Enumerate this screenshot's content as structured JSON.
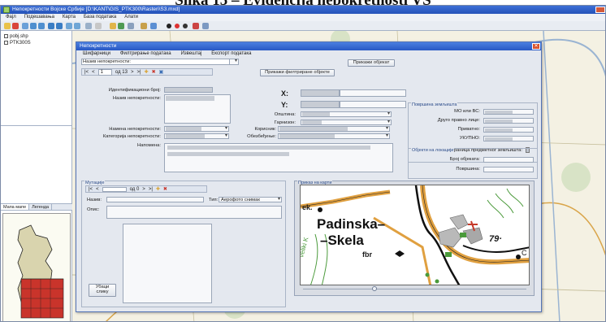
{
  "figure_heading": "Slika 15 – Evidencija nepokretnosti VS",
  "app": {
    "title": "Непокретности Војске Србије [D:\\KANT\\GIS_PTK300\\Rasteri\\S3.mxd]",
    "menu": [
      "Фајл",
      "Подешавања",
      "Карта",
      "База података",
      "Алати"
    ]
  },
  "layers": [
    "pobj.shp",
    "PTK300S"
  ],
  "left_tabs": [
    "Мапа мапе",
    "Легенда"
  ],
  "dialog": {
    "title": "Непокретности",
    "menu": [
      "Шифарници",
      "Филтрирање података",
      "Извештај",
      "Експорт података"
    ],
    "search_label": "Назив непокретности:",
    "show_object_btn": "Прикажи објекат",
    "nav_main": {
      "first": "|<",
      "prev": "<",
      "record": "1",
      "count": "од 13",
      "next": ">",
      "last": ">|",
      "add": "✚",
      "delete": "✖",
      "save": "▣"
    },
    "show_filtered_btn": "Прикажи филтриране објекте",
    "labels": {
      "id": "Идентификациони број:",
      "name": "Назив непокретности:",
      "type": "Намена непокретности:",
      "category": "Категорија непокретности:",
      "note": "Напомена:",
      "x": "X:",
      "y": "Y:",
      "municipality": "Општина:",
      "garrison": "Гарнизон:",
      "user": "Корисник:",
      "security": "Обезбеђење:"
    },
    "surface_group": {
      "title": "Површина земљишта",
      "labels": [
        "МО или ВС:",
        "Друго правно лице:",
        "Приватно:",
        "УКУПНО:",
        "Граница предметног земљишта:"
      ]
    },
    "objects_group": {
      "title": "Објекти на локацији",
      "labels": [
        "Број објеката:",
        "Површина:"
      ]
    },
    "mutations": {
      "title": "Мутације",
      "nav": {
        "first": "|<",
        "prev": "<",
        "count": "од 0",
        "next": ">",
        "last": ">|",
        "add": "✚",
        "delete": "✖"
      },
      "name_label": "Назив:",
      "type_label": "Тип:",
      "type_value": "Аерофото снимак",
      "desc_label": "Опис:",
      "attach_btn": "Убаци слику"
    },
    "map_group_title": "Приказ на карти"
  },
  "map": {
    "town_line1": "Padinska–",
    "town_line2": "–Skela",
    "ek": "ek.",
    "fbr": "fbr",
    "elevation": "79·",
    "canal": "Veliki K",
    "c_label": "C"
  },
  "colors": {
    "road_orange": "#e0a040",
    "map_green": "#4a9a3a",
    "river_black": "#111111"
  }
}
